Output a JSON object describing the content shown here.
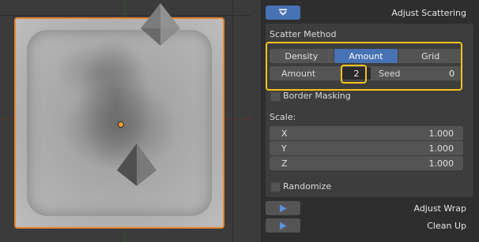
{
  "panel": {
    "adjust_scattering": {
      "label": "Adjust Scattering"
    },
    "scatter_method": {
      "heading": "Scatter Method",
      "options": [
        "Density",
        "Amount",
        "Grid"
      ],
      "selected": "Amount"
    },
    "amount_field": {
      "label": "Amount",
      "value": "2"
    },
    "seed_field": {
      "label": "Seed",
      "value": "0"
    },
    "border_masking": {
      "label": "Border Masking",
      "checked": false
    },
    "scale": {
      "heading": "Scale:",
      "x": {
        "axis": "X",
        "value": "1.000"
      },
      "y": {
        "axis": "Y",
        "value": "1.000"
      },
      "z": {
        "axis": "Z",
        "value": "1.000"
      }
    },
    "randomize": {
      "label": "Randomize",
      "checked": false
    },
    "adjust_wrap": {
      "label": "Adjust Wrap"
    },
    "clean_up": {
      "label": "Clean Up"
    }
  },
  "colors": {
    "accent_blue": "#4772b3",
    "selection_orange": "#e8852d",
    "highlight_yellow": "#f5c31c"
  },
  "icons": [
    "collapse-arrow-icon",
    "play-triangle-icon",
    "pyramid-object-icon"
  ]
}
